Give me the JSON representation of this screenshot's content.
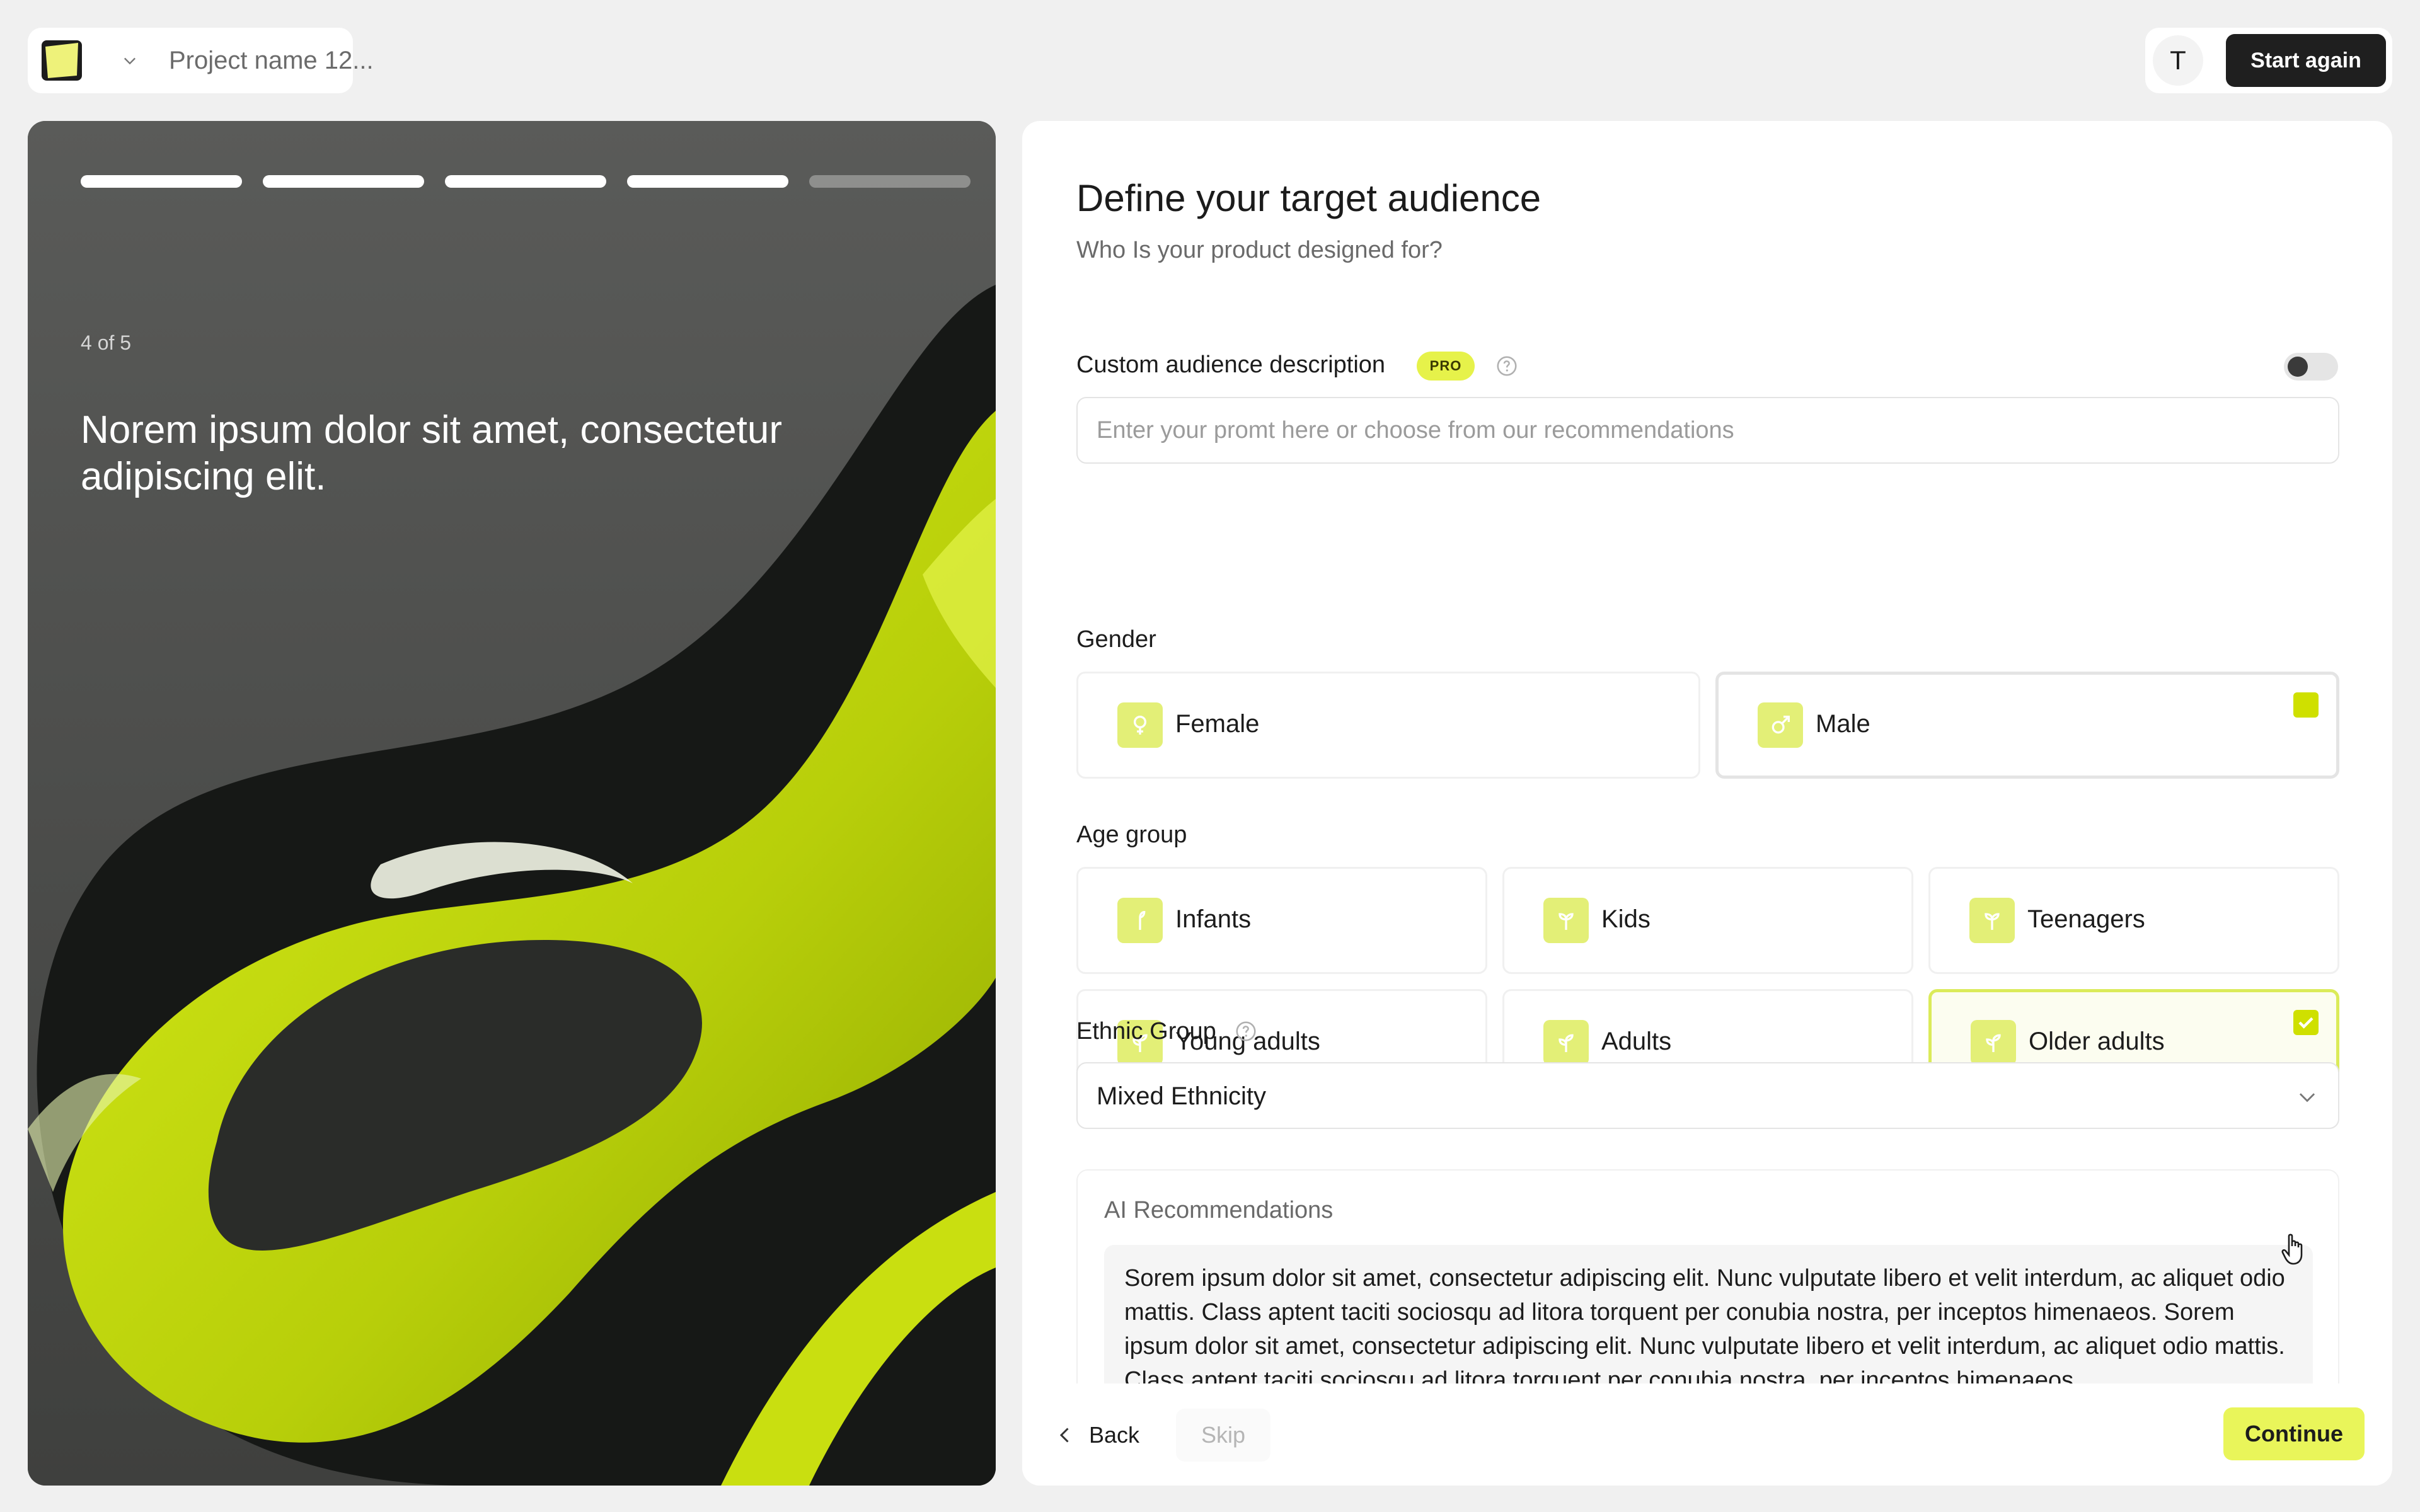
{
  "header": {
    "project_name": "Project name 12...",
    "user_initial": "T",
    "start_again_label": "Start again"
  },
  "hero": {
    "step_label": "4 of 5",
    "progress": {
      "current_step": 4,
      "total_steps": 5
    },
    "title": "Norem ipsum dolor sit amet, consectetur adipiscing elit."
  },
  "form": {
    "title": "Define your target audience",
    "subtitle": "Who Is your product designed for?",
    "custom": {
      "label": "Custom audience description",
      "badge": "PRO",
      "toggle_on": false,
      "placeholder": "Enter your promt here or choose from our recommendations",
      "value": ""
    },
    "gender": {
      "label": "Gender",
      "options": [
        {
          "label": "Female",
          "icon": "female-icon",
          "selected": false
        },
        {
          "label": "Male",
          "icon": "male-icon",
          "selected": true
        }
      ]
    },
    "age": {
      "label": "Age group",
      "options": [
        {
          "label": "Infants",
          "icon": "sprout-icon",
          "selected": false
        },
        {
          "label": "Kids",
          "icon": "sprout-icon",
          "selected": false
        },
        {
          "label": "Teenagers",
          "icon": "sprout-icon",
          "selected": false
        },
        {
          "label": "Young adults",
          "icon": "plant-icon",
          "selected": false
        },
        {
          "label": "Adults",
          "icon": "plant-icon",
          "selected": false
        },
        {
          "label": "Older adults",
          "icon": "plant-icon",
          "selected": true
        }
      ]
    },
    "ethnic": {
      "label": "Ethnic Group",
      "selected": "Mixed Ethnicity"
    },
    "ai": {
      "title": "AI Recommendations",
      "text": "Sorem ipsum dolor sit amet, consectetur adipiscing elit. Nunc vulputate libero et velit interdum, ac aliquet odio mattis. Class aptent taciti sociosqu ad litora torquent per conubia nostra, per inceptos himenaeos. Sorem ipsum dolor sit amet, consectetur adipiscing elit. Nunc vulputate libero et velit interdum, ac aliquet odio mattis. Class aptent taciti sociosqu ad litora torquent per conubia nostra, per inceptos himenaeos."
    }
  },
  "footer": {
    "back_label": "Back",
    "skip_label": "Skip",
    "continue_label": "Continue"
  },
  "colors": {
    "accent": "#e9f55a",
    "accent_strong": "#cfe000",
    "dark_button": "#1f1f1f",
    "page_bg": "#f0f0f0"
  }
}
